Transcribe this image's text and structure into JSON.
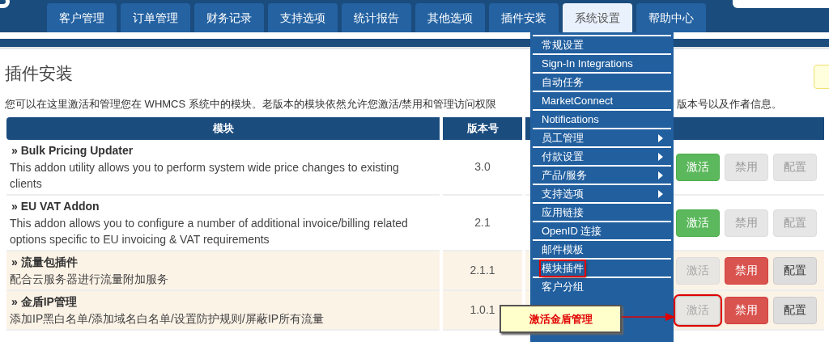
{
  "nav": {
    "tabs": [
      {
        "label": "客户管理",
        "selected": false
      },
      {
        "label": "订单管理",
        "selected": false
      },
      {
        "label": "财务记录",
        "selected": false
      },
      {
        "label": "支持选项",
        "selected": false
      },
      {
        "label": "统计报告",
        "selected": false
      },
      {
        "label": "其他选项",
        "selected": false
      },
      {
        "label": "插件安装",
        "selected": false
      },
      {
        "label": "系统设置",
        "selected": true
      },
      {
        "label": "帮助中心",
        "selected": false
      }
    ]
  },
  "menu": {
    "items": [
      {
        "label": "常规设置",
        "submenu": false,
        "outlined": false
      },
      {
        "label": "Sign-In Integrations",
        "submenu": false,
        "outlined": false
      },
      {
        "label": "自动任务",
        "submenu": false,
        "outlined": false
      },
      {
        "label": "MarketConnect",
        "submenu": false,
        "outlined": false
      },
      {
        "label": "Notifications",
        "submenu": false,
        "outlined": false
      },
      {
        "label": "员工管理",
        "submenu": true,
        "outlined": false
      },
      {
        "label": "付款设置",
        "submenu": true,
        "outlined": false
      },
      {
        "label": "产品/服务",
        "submenu": true,
        "outlined": false
      },
      {
        "label": "支持选项",
        "submenu": true,
        "outlined": false
      },
      {
        "label": "应用链接",
        "submenu": false,
        "outlined": false
      },
      {
        "label": "OpenID 连接",
        "submenu": false,
        "outlined": false
      },
      {
        "label": "邮件模板",
        "submenu": false,
        "outlined": false
      },
      {
        "label": "模块插件",
        "submenu": false,
        "outlined": true
      },
      {
        "label": "客户分组",
        "submenu": false,
        "outlined": false
      }
    ]
  },
  "page": {
    "title": "插件安装",
    "description_start": "您可以在这里激活和管理您在 WHMCS 系统中的模块。老版本的模块依然允许您激活/禁用和管理访问权限",
    "description_end": "版本号以及作者信息。"
  },
  "table": {
    "columns": [
      "模块",
      "版本号"
    ],
    "rows": [
      {
        "name": "» Bulk Pricing Updater",
        "description": "This addon utility allows you to perform system wide price changes to existing clients",
        "version": "3.0",
        "active": false,
        "outlined": false,
        "buttons": [
          "激活",
          "禁用",
          "配置"
        ]
      },
      {
        "name": "» EU VAT Addon",
        "description": "This addon allows you to configure a number of additional invoice/billing related options specific to EU invoicing & VAT requirements",
        "version": "2.1",
        "active": false,
        "outlined": false,
        "buttons": [
          "激活",
          "禁用",
          "配置"
        ]
      },
      {
        "name": "» 流量包插件",
        "description": "配合云服务器进行流量附加服务",
        "version": "2.1.1",
        "active": true,
        "outlined": false,
        "buttons": [
          "激活",
          "禁用",
          "配置"
        ]
      },
      {
        "name": "» 金盾IP管理",
        "description": "添加IP黑白名单/添加域名白名单/设置防护规则/屏蔽IP所有流量",
        "version": "1.0.1",
        "active": true,
        "outlined": true,
        "buttons": [
          "激活",
          "禁用",
          "配置"
        ]
      }
    ]
  },
  "callout": {
    "text": "激活金盾管理"
  }
}
